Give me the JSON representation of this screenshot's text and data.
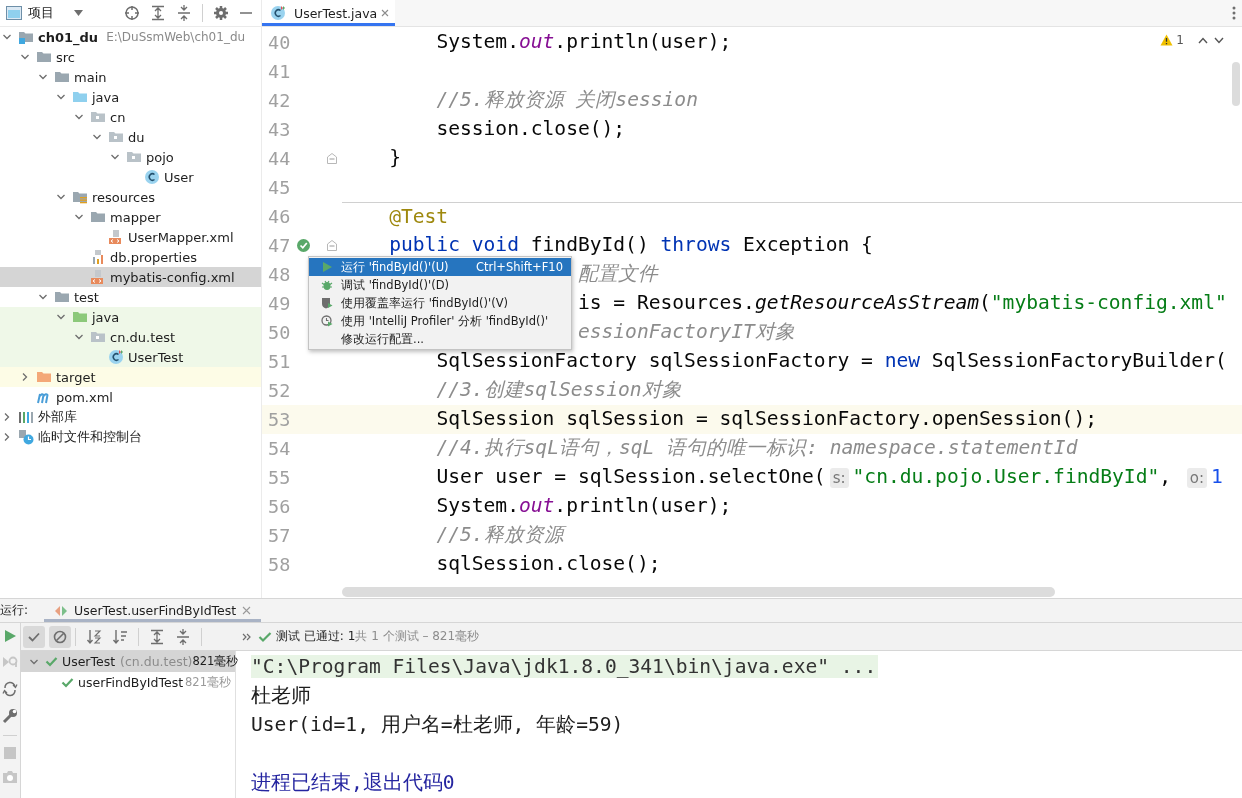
{
  "project_panel": {
    "title": "项目",
    "tree": [
      {
        "label": "ch01_du",
        "path": "E:\\DuSsmWeb\\ch01_du",
        "kind": "module",
        "expanded": true,
        "selected": false,
        "children": [
          {
            "label": "src",
            "kind": "folder",
            "expanded": true,
            "selected": false,
            "children": [
              {
                "label": "main",
                "kind": "folder",
                "expanded": true,
                "selected": false,
                "children": [
                  {
                    "label": "java",
                    "kind": "source",
                    "expanded": true,
                    "selected": false,
                    "children": [
                      {
                        "label": "cn",
                        "kind": "package",
                        "expanded": true,
                        "selected": false,
                        "children": [
                          {
                            "label": "du",
                            "kind": "package",
                            "expanded": true,
                            "selected": false,
                            "children": [
                              {
                                "label": "pojo",
                                "kind": "package",
                                "expanded": true,
                                "selected": false,
                                "children": [
                                  {
                                    "label": "User",
                                    "kind": "class",
                                    "selected": false
                                  }
                                ]
                              }
                            ]
                          }
                        ]
                      }
                    ]
                  },
                  {
                    "label": "resources",
                    "kind": "resources",
                    "expanded": true,
                    "selected": false,
                    "children": [
                      {
                        "label": "mapper",
                        "kind": "folder",
                        "expanded": true,
                        "selected": false,
                        "children": [
                          {
                            "label": "UserMapper.xml",
                            "kind": "xml",
                            "selected": false
                          }
                        ]
                      },
                      {
                        "label": "db.properties",
                        "kind": "properties",
                        "selected": false
                      },
                      {
                        "label": "mybatis-config.xml",
                        "kind": "xml",
                        "selected": true
                      }
                    ]
                  }
                ]
              },
              {
                "label": "test",
                "kind": "folder",
                "expanded": true,
                "selected": false,
                "children": [
                  {
                    "label": "java",
                    "kind": "test-source",
                    "expanded": true,
                    "selected": false,
                    "in_tests": true,
                    "children": [
                      {
                        "label": "cn.du.test",
                        "kind": "package",
                        "expanded": true,
                        "selected": false,
                        "in_tests": true,
                        "children": [
                          {
                            "label": "UserTest",
                            "kind": "test-class",
                            "selected": false,
                            "in_tests": true
                          }
                        ]
                      }
                    ]
                  }
                ]
              }
            ]
          },
          {
            "label": "target",
            "kind": "excluded",
            "expanded": false,
            "selected": false,
            "excluded": true
          },
          {
            "label": "pom.xml",
            "kind": "maven",
            "selected": false
          }
        ]
      },
      {
        "label": "外部库",
        "kind": "libraries",
        "expanded": false,
        "selected": false
      },
      {
        "label": "临时文件和控制台",
        "kind": "scratches",
        "expanded": false,
        "selected": false
      }
    ]
  },
  "editor": {
    "tab": {
      "label": "UserTest.java",
      "selected": true
    },
    "warning_count": "1",
    "lines": [
      {
        "no": "40",
        "tokens": [
          {
            "kind": "plain",
            "text": "        System."
          },
          {
            "kind": "field",
            "text": "out"
          },
          {
            "kind": "plain",
            "text": ".println(user);"
          }
        ]
      },
      {
        "no": "41"
      },
      {
        "no": "42",
        "tokens": [
          {
            "kind": "comment",
            "text": "        //5.释放资源 关闭session"
          }
        ]
      },
      {
        "no": "43",
        "tokens": [
          {
            "kind": "plain",
            "text": "        session.close();"
          }
        ]
      },
      {
        "no": "44",
        "fold": true,
        "tokens": [
          {
            "kind": "plain",
            "text": "    }"
          }
        ]
      },
      {
        "no": "45"
      },
      {
        "no": "46",
        "separator": true,
        "tokens": [
          {
            "kind": "annotation",
            "text": "    @Test"
          }
        ]
      },
      {
        "no": "47",
        "run_marker": true,
        "fold": true,
        "tokens": [
          {
            "kind": "keyword",
            "text": "    public void "
          },
          {
            "kind": "plain",
            "text": "findById() "
          },
          {
            "kind": "keyword",
            "text": "throws "
          },
          {
            "kind": "plain",
            "text": "Exception {"
          }
        ]
      },
      {
        "no": "48",
        "tokens": [
          {
            "kind": "comment",
            "text": "                    配置文件"
          }
        ]
      },
      {
        "no": "49",
        "tokens": [
          {
            "kind": "plain",
            "text": "                    is = Resources."
          },
          {
            "kind": "static",
            "text": "getResourceAsStream"
          },
          {
            "kind": "plain",
            "text": "("
          },
          {
            "kind": "string",
            "text": "\"mybatis-config.xml\""
          }
        ]
      },
      {
        "no": "50",
        "tokens": [
          {
            "kind": "comment",
            "text": "                    essionFactoryIT对象"
          }
        ]
      },
      {
        "no": "51",
        "tokens": [
          {
            "kind": "plain",
            "text": "        SqlSessionFactory sqlSessionFactory = "
          },
          {
            "kind": "keyword",
            "text": "new "
          },
          {
            "kind": "plain",
            "text": "SqlSessionFactoryBuilder("
          }
        ]
      },
      {
        "no": "52",
        "tokens": [
          {
            "kind": "comment",
            "text": "        //3.创建sqlSession对象"
          }
        ]
      },
      {
        "no": "53",
        "current": true,
        "tokens": [
          {
            "kind": "plain",
            "text": "        SqlSession sqlSession = sqlSessionFactory.openSession();"
          }
        ]
      },
      {
        "no": "54",
        "tokens": [
          {
            "kind": "comment",
            "text": "        //4.执行sqL语句，sqL 语句的唯一标识: namespace.statementId"
          }
        ]
      },
      {
        "no": "55",
        "tokens": [
          {
            "kind": "plain",
            "text": "        User user = sqlSession.selectOne("
          },
          {
            "kind": "hint",
            "text": "s:"
          },
          {
            "kind": "string",
            "text": "\"cn.du.pojo.User.findById\""
          },
          {
            "kind": "plain",
            "text": ", "
          },
          {
            "kind": "hint",
            "text": "o:"
          },
          {
            "kind": "number",
            "text": "1"
          }
        ]
      },
      {
        "no": "56",
        "tokens": [
          {
            "kind": "plain",
            "text": "        System."
          },
          {
            "kind": "field",
            "text": "out"
          },
          {
            "kind": "plain",
            "text": ".println(user);"
          }
        ]
      },
      {
        "no": "57",
        "tokens": [
          {
            "kind": "comment",
            "text": "        //5.释放资源"
          }
        ]
      },
      {
        "no": "58",
        "tokens": [
          {
            "kind": "plain",
            "text": "        sqlSession.close();"
          }
        ]
      }
    ],
    "context_menu": {
      "items": [
        {
          "kind": "run",
          "label": "运行 'findById()'(U)",
          "shortcut": "Ctrl+Shift+F10",
          "selected": true
        },
        {
          "kind": "debug",
          "label": "调试 'findById()'(D)",
          "selected": false
        },
        {
          "kind": "coverage",
          "label": "使用覆盖率运行  'findById()'(V)",
          "selected": false
        },
        {
          "kind": "profiler",
          "label": "使用 'IntelliJ Profiler' 分析  'findById()'",
          "selected": false
        },
        {
          "kind": "plain",
          "label": "修改运行配置...",
          "selected": false
        }
      ]
    }
  },
  "run_panel": {
    "label": "运行:",
    "tab": {
      "label": "UserTest.userFindByIdTest",
      "selected": true
    },
    "toggles": [
      {
        "kind": "show-passed",
        "on": true
      },
      {
        "kind": "show-ignored",
        "on": true
      }
    ],
    "status_label": "测试 已通过: 1",
    "status_detail": "共 1 个测试 – 821毫秒",
    "tests": [
      {
        "name": "UserTest",
        "package": "(cn.du.test)",
        "time": "821毫秒",
        "passed": true,
        "selected": true,
        "expanded": true,
        "children": [
          {
            "name": "userFindByIdTest",
            "time": "821毫秒",
            "passed": true,
            "selected": false
          }
        ]
      }
    ],
    "console": [
      {
        "kind": "command",
        "text": "\"C:\\Program Files\\Java\\jdk1.8.0_341\\bin\\java.exe\" ..."
      },
      {
        "kind": "output",
        "text": "杜老师"
      },
      {
        "kind": "output",
        "text": "User(id=1, 用户名=杜老师, 年龄=59)"
      },
      {
        "kind": "exit",
        "text": "进程已结束,退出代码0"
      }
    ]
  }
}
